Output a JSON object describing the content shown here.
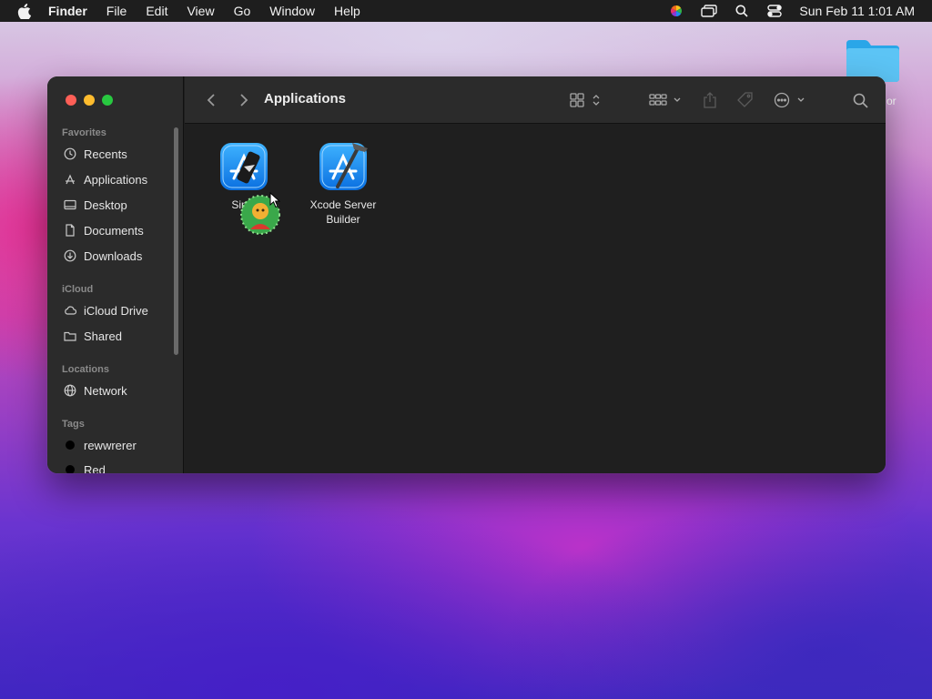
{
  "menubar": {
    "app_name": "Finder",
    "items": [
      "File",
      "Edit",
      "View",
      "Go",
      "Window",
      "Help"
    ],
    "clock": "Sun Feb 11  1:01 AM"
  },
  "desktop": {
    "folder_label_visible": "or"
  },
  "window": {
    "title": "Applications",
    "sidebar": {
      "favorites_header": "Favorites",
      "favorites": [
        "Recents",
        "Applications",
        "Desktop",
        "Documents",
        "Downloads"
      ],
      "icloud_header": "iCloud",
      "icloud": [
        "iCloud Drive",
        "Shared"
      ],
      "locations_header": "Locations",
      "locations": [
        "Network"
      ],
      "tags_header": "Tags",
      "tags": [
        "rewwrerer",
        "Red"
      ]
    },
    "files": [
      {
        "name": "Simu",
        "icon": "simulator-icon"
      },
      {
        "name": "Xcode Server Builder",
        "icon": "xcode-server-builder-icon"
      }
    ]
  },
  "colors": {
    "close": "#fe5f57",
    "minimize": "#febc2e",
    "maximize": "#28c840",
    "accent_blue": "#1e8cf0"
  }
}
